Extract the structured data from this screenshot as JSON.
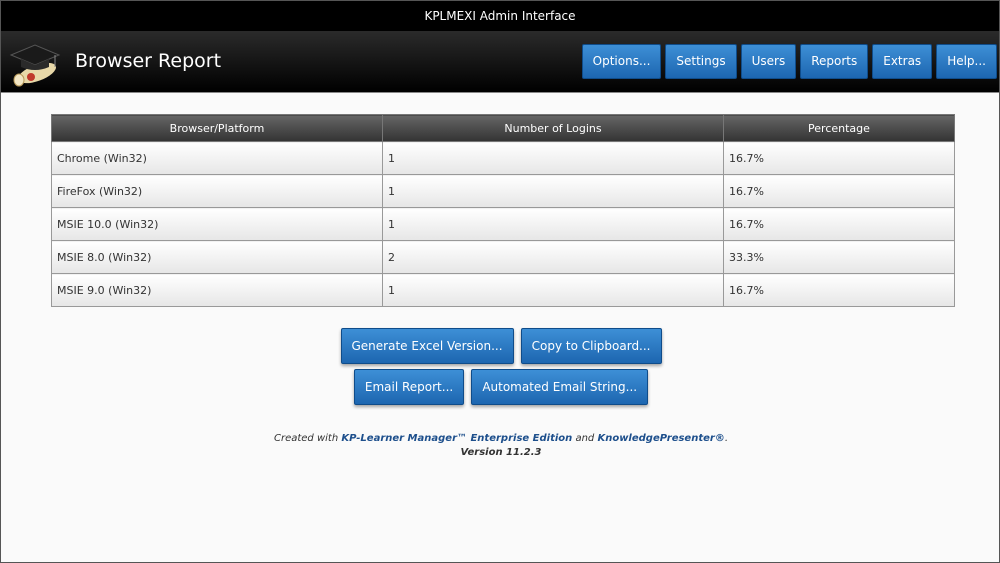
{
  "window": {
    "title": "KPLMEXI Admin Interface"
  },
  "header": {
    "page_title": "Browser Report",
    "nav": [
      "Options...",
      "Settings",
      "Users",
      "Reports",
      "Extras",
      "Help..."
    ]
  },
  "table": {
    "headers": [
      "Browser/Platform",
      "Number of Logins",
      "Percentage"
    ],
    "rows": [
      [
        "Chrome (Win32)",
        "1",
        "16.7%"
      ],
      [
        "FireFox (Win32)",
        "1",
        "16.7%"
      ],
      [
        "MSIE 10.0 (Win32)",
        "1",
        "16.7%"
      ],
      [
        "MSIE 8.0 (Win32)",
        "2",
        "33.3%"
      ],
      [
        "MSIE 9.0 (Win32)",
        "1",
        "16.7%"
      ]
    ]
  },
  "actions": {
    "generate_excel": "Generate Excel Version...",
    "copy_clipboard": "Copy to Clipboard...",
    "email_report": "Email Report...",
    "automated_email": "Automated Email String..."
  },
  "footer": {
    "created_with": "Created with ",
    "product": "KP-Learner Manager™ Enterprise Edition",
    "and": " and ",
    "presenter": "KnowledgePresenter®",
    "period": ".",
    "version": "Version 11.2.3"
  },
  "colors": {
    "accent": "#1d66b0",
    "header_bg": "#000000"
  }
}
